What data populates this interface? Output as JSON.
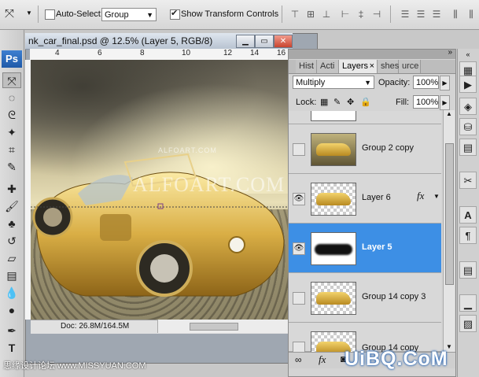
{
  "options_bar": {
    "tool_icon": "move-tool-icon",
    "auto_select_label": "Auto-Select:",
    "auto_select_checked": false,
    "auto_select_value": "Group",
    "show_transform_label": "Show Transform Controls",
    "show_transform_checked": true
  },
  "app": {
    "logo": "Ps"
  },
  "document": {
    "title": "nk_car_final.psd @ 12.5% (Layer 5, RGB/8)",
    "ruler_ticks": [
      "4",
      "6",
      "8",
      "10",
      "12",
      "14",
      "16"
    ],
    "watermark_large": "ALFOART.COM",
    "watermark_small": "ALFOART.COM",
    "doc_size": "Doc: 26.8M/164.5M"
  },
  "panel": {
    "tabs": [
      "Hist",
      "Acti",
      "Layers",
      "shes",
      "urce"
    ],
    "active_tab": "Layers",
    "blend_mode": "Multiply",
    "opacity_label": "Opacity:",
    "opacity_value": "100%",
    "lock_label": "Lock:",
    "fill_label": "Fill:",
    "fill_value": "100%",
    "layers": [
      {
        "name": "",
        "visible": false,
        "selected": false
      },
      {
        "name": "Group 2 copy",
        "visible": false,
        "selected": false
      },
      {
        "name": "Layer 6",
        "visible": true,
        "selected": false,
        "fx": "fx"
      },
      {
        "name": "Layer 5",
        "visible": true,
        "selected": true
      },
      {
        "name": "Group 14 copy 3",
        "visible": false,
        "selected": false
      },
      {
        "name": "Group 14 copy",
        "visible": false,
        "selected": false
      }
    ]
  },
  "credit": {
    "site": "思缘设计论坛 www.MISSYUAN.COM",
    "logo": "UiBQ.CoM"
  }
}
